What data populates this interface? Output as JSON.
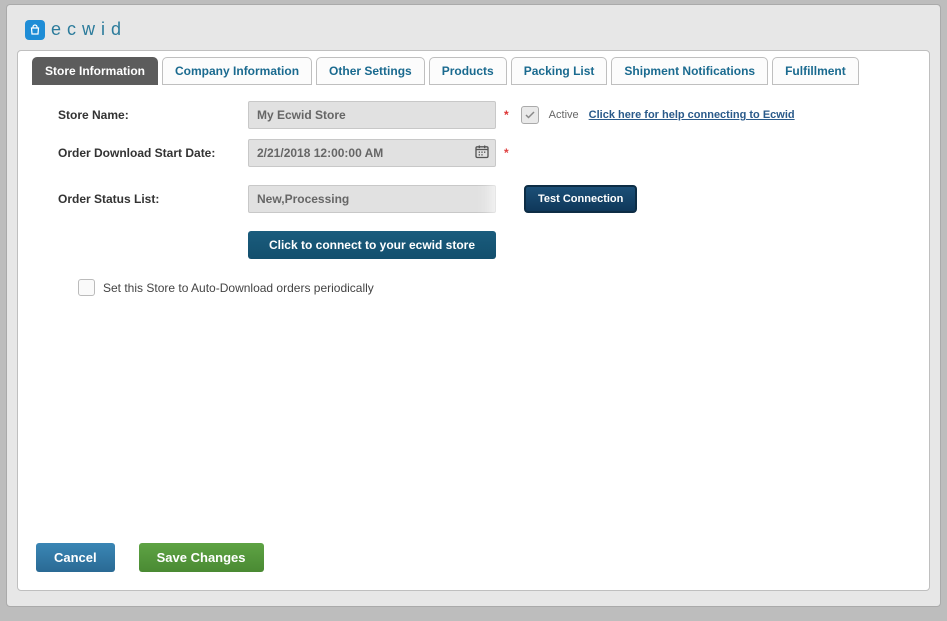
{
  "logo": {
    "icon": "bag-icon",
    "text": "ecwid"
  },
  "tabs": [
    {
      "label": "Store Information",
      "active": true
    },
    {
      "label": "Company Information",
      "active": false
    },
    {
      "label": "Other Settings",
      "active": false
    },
    {
      "label": "Products",
      "active": false
    },
    {
      "label": "Packing List",
      "active": false
    },
    {
      "label": "Shipment Notifications",
      "active": false
    },
    {
      "label": "Fulfillment",
      "active": false
    }
  ],
  "form": {
    "store_name_label": "Store Name:",
    "store_name_value": "My Ecwid Store",
    "download_date_label": "Order Download Start Date:",
    "download_date_value": "2/21/2018 12:00:00 AM",
    "order_status_label": "Order Status List:",
    "order_status_value": "New,Processing",
    "active_checkbox_label": "Active",
    "active_checked": true,
    "help_link": "Click here for help connecting to Ecwid",
    "test_connection_label": "Test Connection",
    "connect_button_label": "Click to connect to your ecwid store",
    "auto_download_label": "Set this Store to Auto-Download orders periodically",
    "auto_download_checked": false
  },
  "footer": {
    "cancel_label": "Cancel",
    "save_label": "Save Changes"
  }
}
